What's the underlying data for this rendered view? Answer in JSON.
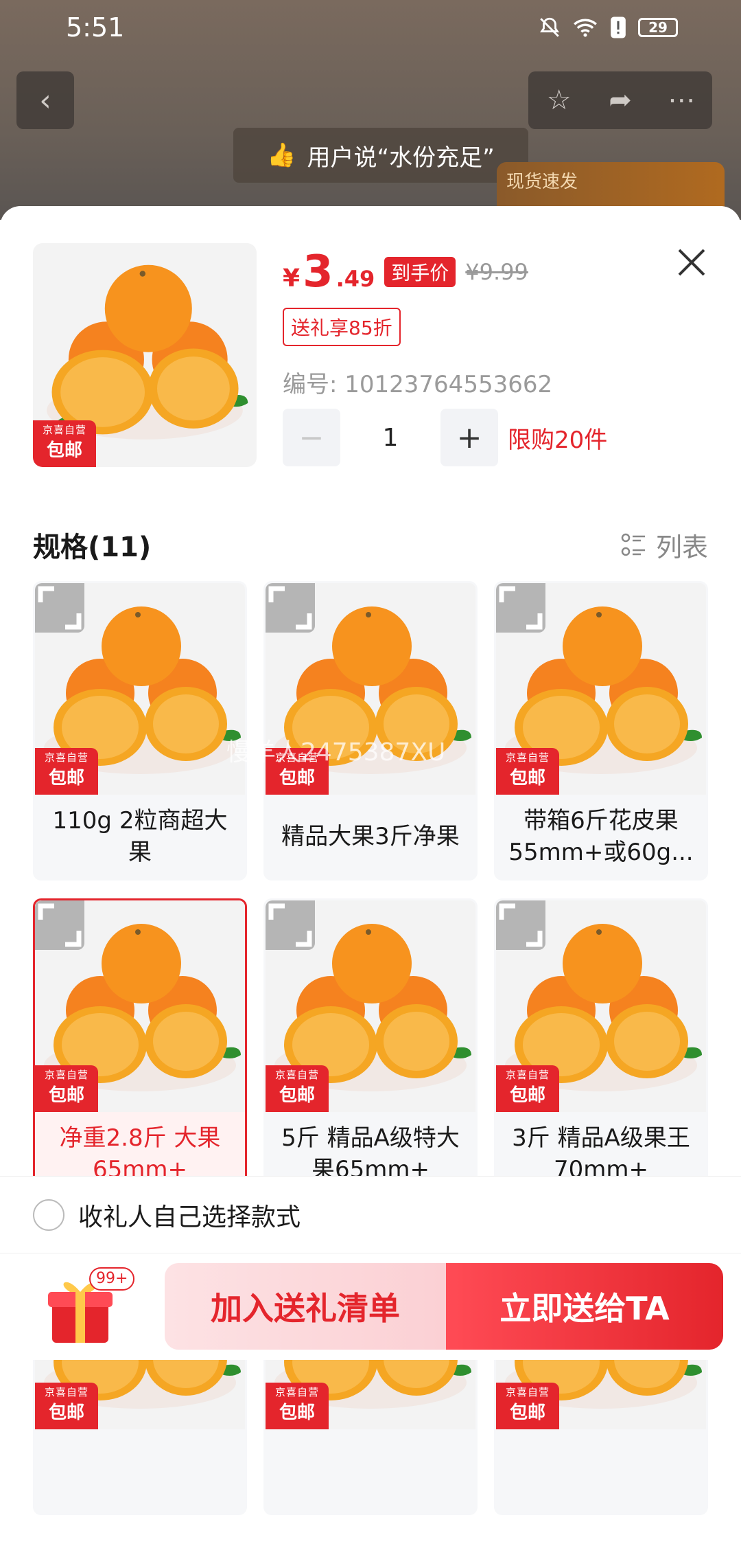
{
  "status_bar": {
    "time": "5:51",
    "battery": "29"
  },
  "background": {
    "user_say": "用户说“水份充足”",
    "instock_tag": "现货速发"
  },
  "product": {
    "price_symbol": "¥",
    "price_int": "3",
    "price_dec": ".49",
    "price_tag": "到手价",
    "original_price": "¥9.99",
    "gift_discount": "送礼享85折",
    "sku_number": "编号: 10123764553662",
    "quantity": "1",
    "limit": "限购20件",
    "badge_line1": "京喜自营",
    "badge_line2": "包邮"
  },
  "spec": {
    "title": "规格(11)",
    "list_toggle": "列表",
    "items": [
      {
        "label": "110g 2粒商超大果",
        "selected": false
      },
      {
        "label": "精品大果3斤净果",
        "selected": false
      },
      {
        "label": "带箱6斤花皮果55mm+或60g...",
        "selected": false
      },
      {
        "label": "净重2.8斤 大果65mm+",
        "selected": true
      },
      {
        "label": "5斤 精品A级特大果65mm+",
        "selected": false
      },
      {
        "label": "3斤 精品A级果王70mm+",
        "selected": false
      },
      {
        "label": "",
        "selected": false
      },
      {
        "label": "",
        "selected": false
      },
      {
        "label": "",
        "selected": false
      }
    ]
  },
  "watermark": "慢羊人2475387XU",
  "recipient_choice": "收礼人自己选择款式",
  "bottom": {
    "gift_badge": "99+",
    "add_label": "加入送礼清单",
    "send_label": "立即送给TA"
  },
  "colors": {
    "accent": "#e4252c"
  }
}
